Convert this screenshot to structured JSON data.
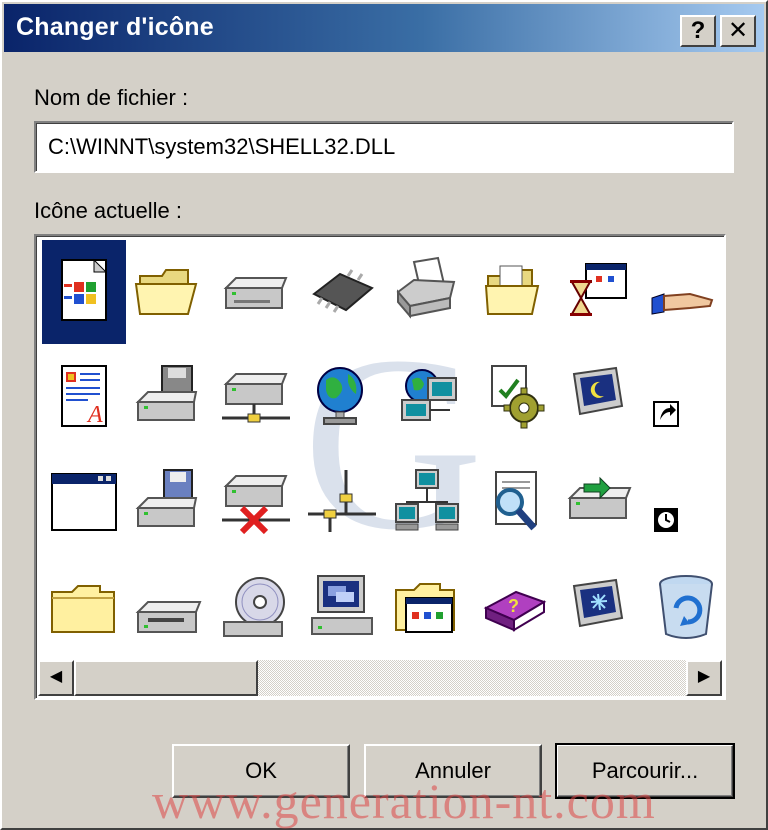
{
  "window": {
    "title": "Changer d'icône",
    "help_glyph": "?",
    "close_glyph": "✕"
  },
  "filename": {
    "label": "Nom de fichier :",
    "value": "C:\\WINNT\\system32\\SHELL32.DLL"
  },
  "icons": {
    "label": "Icône actuelle :",
    "selected_index": 0,
    "items": [
      "windows-document-icon",
      "folder-open-icon",
      "drive-icon",
      "chip-icon",
      "printer-icon",
      "folder-documents-icon",
      "window-hourglass-icon",
      "sharing-hand-icon",
      "document-a-icon",
      "drive-disk-icon",
      "network-drive-icon",
      "globe-icon",
      "network-globe-icon",
      "settings-gear-icon",
      "monitor-moon-icon",
      "shortcut-arrow-icon",
      "window-icon",
      "floppy-drive-icon",
      "disconnected-drive-icon",
      "network-cable-icon",
      "network-computers-icon",
      "find-document-icon",
      "drive-arrow-icon",
      "clock-overlay-icon",
      "folder-closed-icon",
      "cd-drive-icon",
      "cd-rom-icon",
      "computer-icon",
      "folder-window-icon",
      "help-book-icon",
      "monitor-snow-icon",
      "recycle-bin-icon"
    ]
  },
  "scrollbar": {
    "left_glyph": "◀",
    "right_glyph": "▶"
  },
  "buttons": {
    "ok": "OK",
    "cancel": "Annuler",
    "browse": "Parcourir..."
  },
  "watermarks": {
    "site": "www.generation-nt.com"
  },
  "colors": {
    "title_start": "#0a246a",
    "title_end": "#a6caf0",
    "face": "#d4d0c8",
    "selection": "#0a246a"
  }
}
